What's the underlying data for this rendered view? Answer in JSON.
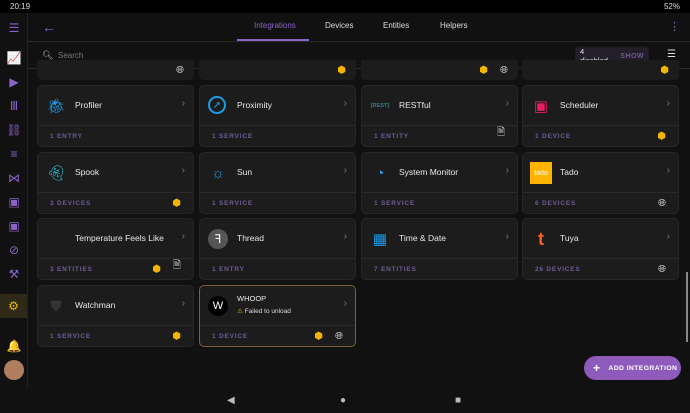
{
  "status": {
    "time": "20:19",
    "battery": "52%"
  },
  "header": {
    "tabs": [
      "Integrations",
      "Devices",
      "Entities",
      "Helpers"
    ]
  },
  "search": {
    "placeholder": "Search",
    "disabled": "4 disabled",
    "show": "SHOW"
  },
  "cards": [
    {
      "name": "Profiler",
      "count": "1 ENTRY",
      "icon": "bug-icon"
    },
    {
      "name": "Proximity",
      "count": "1 SERVICE",
      "icon": "compass-icon"
    },
    {
      "name": "RESTful",
      "count": "1 ENTITY",
      "icon": "rest-icon",
      "icon_text": "[REST]"
    },
    {
      "name": "Scheduler",
      "count": "1 DEVICE",
      "icon": "calendar-icon"
    },
    {
      "name": "Spook",
      "count": "3 DEVICES",
      "icon": "ghost-icon"
    },
    {
      "name": "Sun",
      "count": "1 SERVICE",
      "icon": "sun-icon"
    },
    {
      "name": "System Monitor",
      "count": "1 SERVICE",
      "icon": "gauge-icon"
    },
    {
      "name": "Tado",
      "count": "6 DEVICES",
      "icon": "tado-logo-icon",
      "icon_text": "tado"
    },
    {
      "name": "Temperature Feels Like",
      "count": "3 ENTITIES",
      "icon": "none"
    },
    {
      "name": "Thread",
      "count": "1 ENTRY",
      "icon": "thread-icon"
    },
    {
      "name": "Time & Date",
      "count": "7 ENTITIES",
      "icon": "calendar-clock-icon"
    },
    {
      "name": "Tuya",
      "count": "26 DEVICES",
      "icon": "tuya-icon"
    },
    {
      "name": "Watchman",
      "count": "1 SERVICE",
      "icon": "shield-icon"
    },
    {
      "name": "WHOOP",
      "count": "1 DEVICE",
      "icon": "whoop-icon",
      "error": "Failed to unload"
    }
  ],
  "fab": {
    "label": "ADD INTEGRATION"
  },
  "colors": {
    "accent": "#8e5bbd",
    "custom": "#f4b400"
  }
}
